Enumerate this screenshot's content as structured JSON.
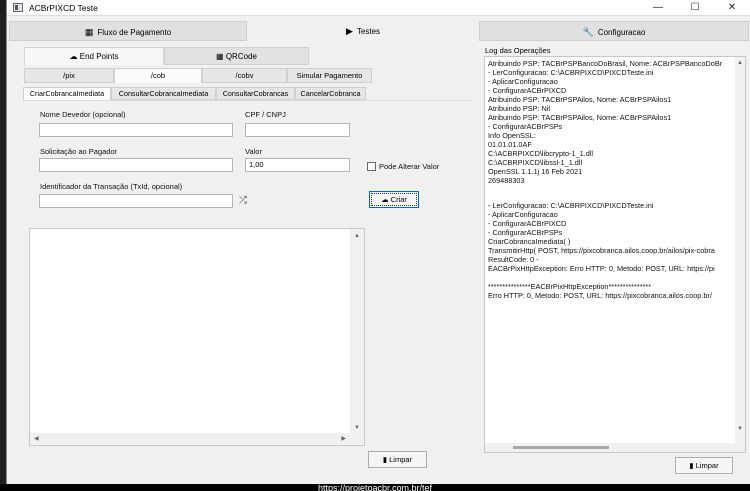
{
  "window": {
    "title": "ACBrPIXCD Teste"
  },
  "top_tabs": [
    {
      "label": "Fluxo de Pagamento",
      "icon": "qr-grid-icon"
    },
    {
      "label": "Testes",
      "icon": "play-icon"
    },
    {
      "label": "Configuracao",
      "icon": "wrench-icon"
    }
  ],
  "sub_tabs": [
    {
      "label": "End Points",
      "icon": "cloud-icon"
    },
    {
      "label": "QRCode",
      "icon": "qr-grid-icon"
    }
  ],
  "pix_tabs": [
    "/pix",
    "/cob",
    "/cobv",
    "Simular Pagamento"
  ],
  "cob_tabs": [
    "CriarCobrancaImediata",
    "ConsultarCobrancaImediata",
    "ConsultarCobrancas",
    "CancelarCobranca"
  ],
  "form": {
    "nome_devedor_label": "Nome Devedor (opcional)",
    "nome_devedor_value": "",
    "cpf_cnpj_label": "CPF / CNPJ",
    "cpf_cnpj_value": "",
    "solicitacao_label": "Solicitação ao Pagador",
    "solicitacao_value": "",
    "valor_label": "Valor",
    "valor_value": "1,00",
    "pode_alterar_label": "Pode Alterar Valor",
    "pode_alterar_checked": false,
    "txid_label": "Identificador da Transação (TxId, opcional)",
    "txid_value": "",
    "criar_label": "Criar"
  },
  "limpar_left": "Limpar",
  "log": {
    "label": "Log das Operações",
    "lines": [
      "Atribuindo PSP: TACBrPSPBancoDoBrasil, Nome: ACBrPSPBancoDoBr",
      "- LerConfiguracao: C:\\ACBRPIXCD\\PIXCDTeste.ini",
      "- AplicarConfiguracao",
      "  - ConfigurarACBrPIXCD",
      "Atribuindo PSP: TACBrPSPAilos, Nome: ACBrPSPAilos1",
      "Atribuindo PSP: Nil",
      "Atribuindo PSP: TACBrPSPAilos, Nome: ACBrPSPAilos1",
      "  - ConfigurarACBrPSPs",
      "Info OpenSSL:",
      "01.01.01.0AF",
      "C:\\ACBRPIXCD\\libcrypto-1_1.dll",
      "C:\\ACBRPIXCD\\libssl-1_1.dll",
      "OpenSSL 1.1.1j  16 Feb 2021",
      "269488303",
      "",
      "- LerConfiguracao: C:\\ACBRPIXCD\\PIXCDTeste.ini",
      "- AplicarConfiguracao",
      "  - ConfigurarACBrPIXCD",
      "  - ConfigurarACBrPSPs",
      "CriarCobrancaImediata( )",
      "TransmitirHttp( POST, https://pixcobranca.ailos.coop.br/ailos/pix-cobra",
      "  ResultCode: 0 -",
      "EACBrPixHttpException: Erro HTTP: 0, Metodo: POST, URL: https://pi",
      "",
      "***************EACBrPixHttpException***************",
      "Erro HTTP: 0, Metodo: POST, URL: https://pixcobranca.ailos.coop.br/"
    ],
    "limpar_label": "Limpar"
  },
  "footer": {
    "url": "https://projetoacbr.com.br/tef"
  }
}
